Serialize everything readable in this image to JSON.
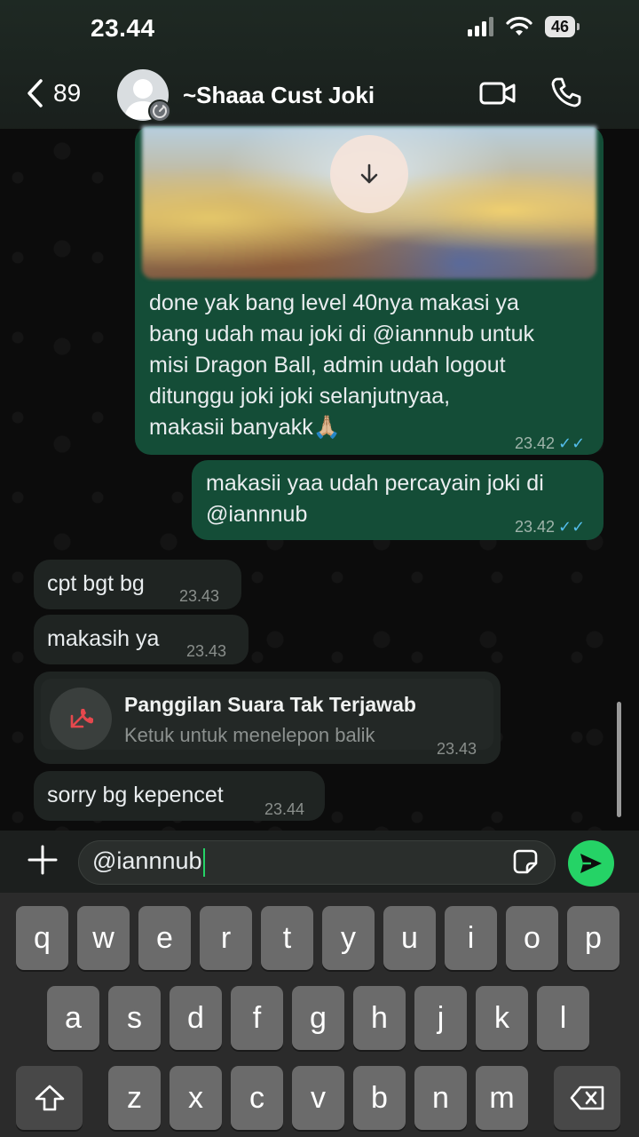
{
  "status_bar": {
    "time": "23.44",
    "battery": "46"
  },
  "header": {
    "back_count": "89",
    "contact_name": "~Shaaa Cust Joki"
  },
  "messages": [
    {
      "type": "image_text",
      "direction": "out",
      "text_lines": [
        "done yak bang level 40nya makasi ya",
        "bang udah mau joki di @iannnub untuk",
        "misi Dragon Ball, admin udah logout",
        "ditunggu joki joki selanjutnyaa,",
        "makasii banyakk🙏🏼"
      ],
      "time": "23.42"
    },
    {
      "type": "text",
      "direction": "out",
      "text_lines": [
        "makasii yaa udah percayain joki di",
        "@iannnub"
      ],
      "time": "23.42"
    },
    {
      "type": "text",
      "direction": "in",
      "text": "cpt bgt bg",
      "time": "23.43"
    },
    {
      "type": "text",
      "direction": "in",
      "text": "makasih ya",
      "time": "23.43"
    },
    {
      "type": "missed_call",
      "direction": "in",
      "title": "Panggilan Suara Tak Terjawab",
      "subtitle": "Ketuk untuk menelepon balik",
      "time": "23.43"
    },
    {
      "type": "text",
      "direction": "in",
      "text": "sorry bg kepencet",
      "time": "23.44"
    }
  ],
  "composer": {
    "text": "@iannnub"
  },
  "keyboard": {
    "row1": [
      "q",
      "w",
      "e",
      "r",
      "t",
      "y",
      "u",
      "i",
      "o",
      "p"
    ],
    "row2": [
      "a",
      "s",
      "d",
      "f",
      "g",
      "h",
      "j",
      "k",
      "l"
    ],
    "row3": [
      "z",
      "x",
      "c",
      "v",
      "b",
      "n",
      "m"
    ]
  },
  "colors": {
    "accent": "#25d366",
    "outgoing_bubble": "#144d37",
    "incoming_bubble": "#1f2422",
    "read_ticks": "#53bdeb"
  }
}
